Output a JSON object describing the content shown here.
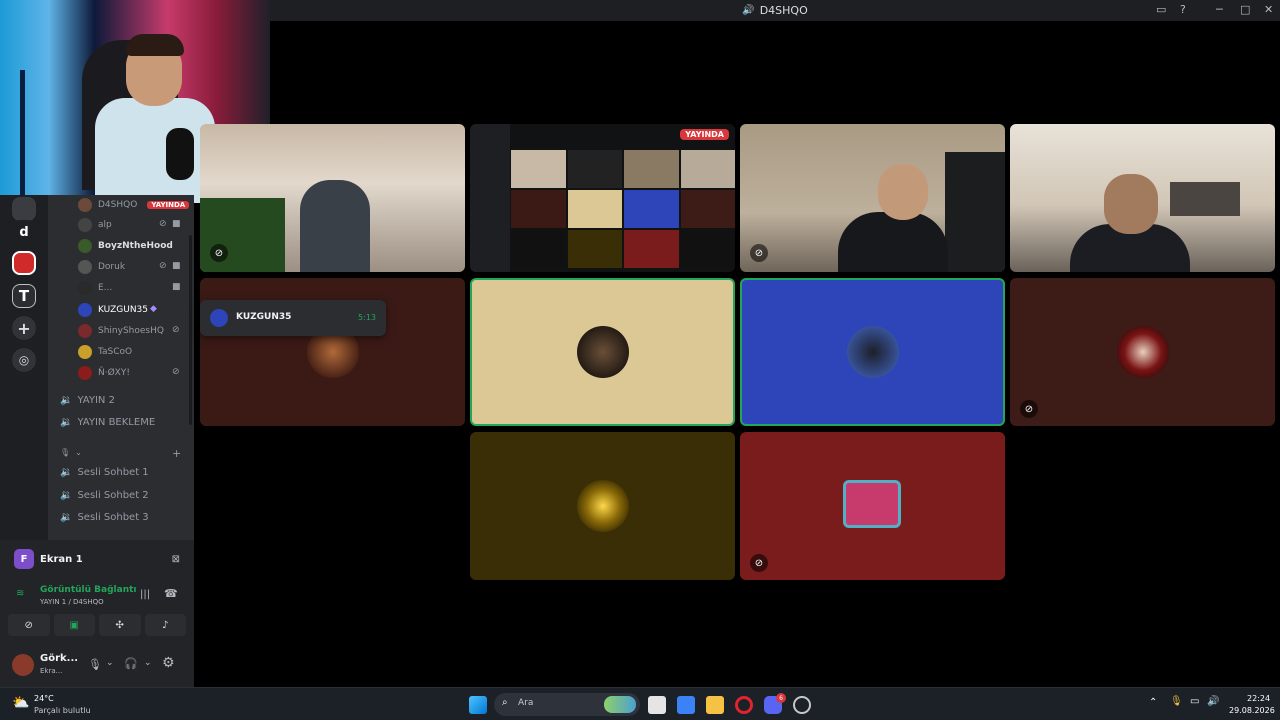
{
  "window": {
    "title": "D4SHQO"
  },
  "channel_list": {
    "users": [
      {
        "name": "D4SHQO",
        "badge": "YAYINDA"
      },
      {
        "name": "alp"
      },
      {
        "name": "BoyzNtheHood"
      },
      {
        "name": "Doruk"
      },
      {
        "name": "E..."
      },
      {
        "name": "KUZGUN35"
      },
      {
        "name": "ShinyShoesHQ"
      },
      {
        "name": "TaSCoO"
      },
      {
        "name": "Ñ·ØXY!"
      }
    ],
    "channels_a": [
      "YAYIN 2",
      "YAYIN BEKLEME"
    ],
    "channels_b": [
      "Sesli Sohbet 1",
      "Sesli Sohbet 2",
      "Sesli Sohbet 3"
    ]
  },
  "tooltip": {
    "name": "KUZGUN35",
    "time": "5:13"
  },
  "voice_panel": {
    "stream_name": "Ekran 1",
    "stream_initial": "F",
    "status": "Görüntülü Bağlantı",
    "location": "YAYIN 1 / D4SHQO",
    "user_name": "Görk...",
    "user_status": "Ekra..."
  },
  "stage": {
    "live_label": "YAYINDA"
  },
  "server_rail": {
    "initial": "d"
  },
  "taskbar": {
    "weather_temp": "24°C",
    "weather_desc": "Parçalı bulutlu",
    "search_placeholder": "Ara",
    "time": "22:24",
    "date": "29.08.2026",
    "notif_count": "6"
  },
  "colors": {
    "accent": "#5865f2",
    "live": "#da373c",
    "connected_green": "#23a55a",
    "tile_brown": "#3b1a16",
    "tile_beige": "#dcc895",
    "tile_blue": "#2d45b8",
    "tile_maroon": "#3d1b17",
    "tile_olive": "#3a2e06",
    "tile_red": "#7a1c1c"
  }
}
